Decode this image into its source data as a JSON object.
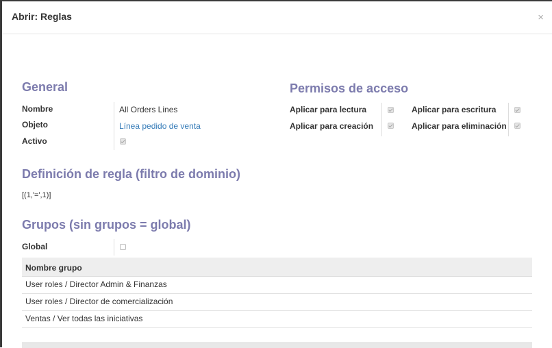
{
  "dialog": {
    "title": "Abrir: Reglas",
    "close_label": "×"
  },
  "general": {
    "title": "General",
    "fields": [
      {
        "label": "Nombre",
        "value": "All Orders Lines"
      },
      {
        "label": "Objeto",
        "value": "Línea pedido de venta"
      },
      {
        "label": "Activo",
        "checked": true
      }
    ]
  },
  "permissions": {
    "title": "Permisos de acceso",
    "read_label": "Aplicar para lectura",
    "write_label": "Aplicar para escritura",
    "create_label": "Aplicar para creación",
    "delete_label": "Aplicar para eliminación",
    "read": true,
    "write": true,
    "create": true,
    "delete": true
  },
  "domain": {
    "title": "Definición de regla (filtro de dominio)",
    "value": "[(1,'=',1)]"
  },
  "groups": {
    "title": "Grupos (sin grupos = global)",
    "global_label": "Global",
    "global": false,
    "column_header": "Nombre grupo",
    "rows": [
      "User roles / Director Admin & Finanzas",
      "User roles / Director de comercialización",
      "Ventas / Ver todas las iniciativas"
    ]
  }
}
